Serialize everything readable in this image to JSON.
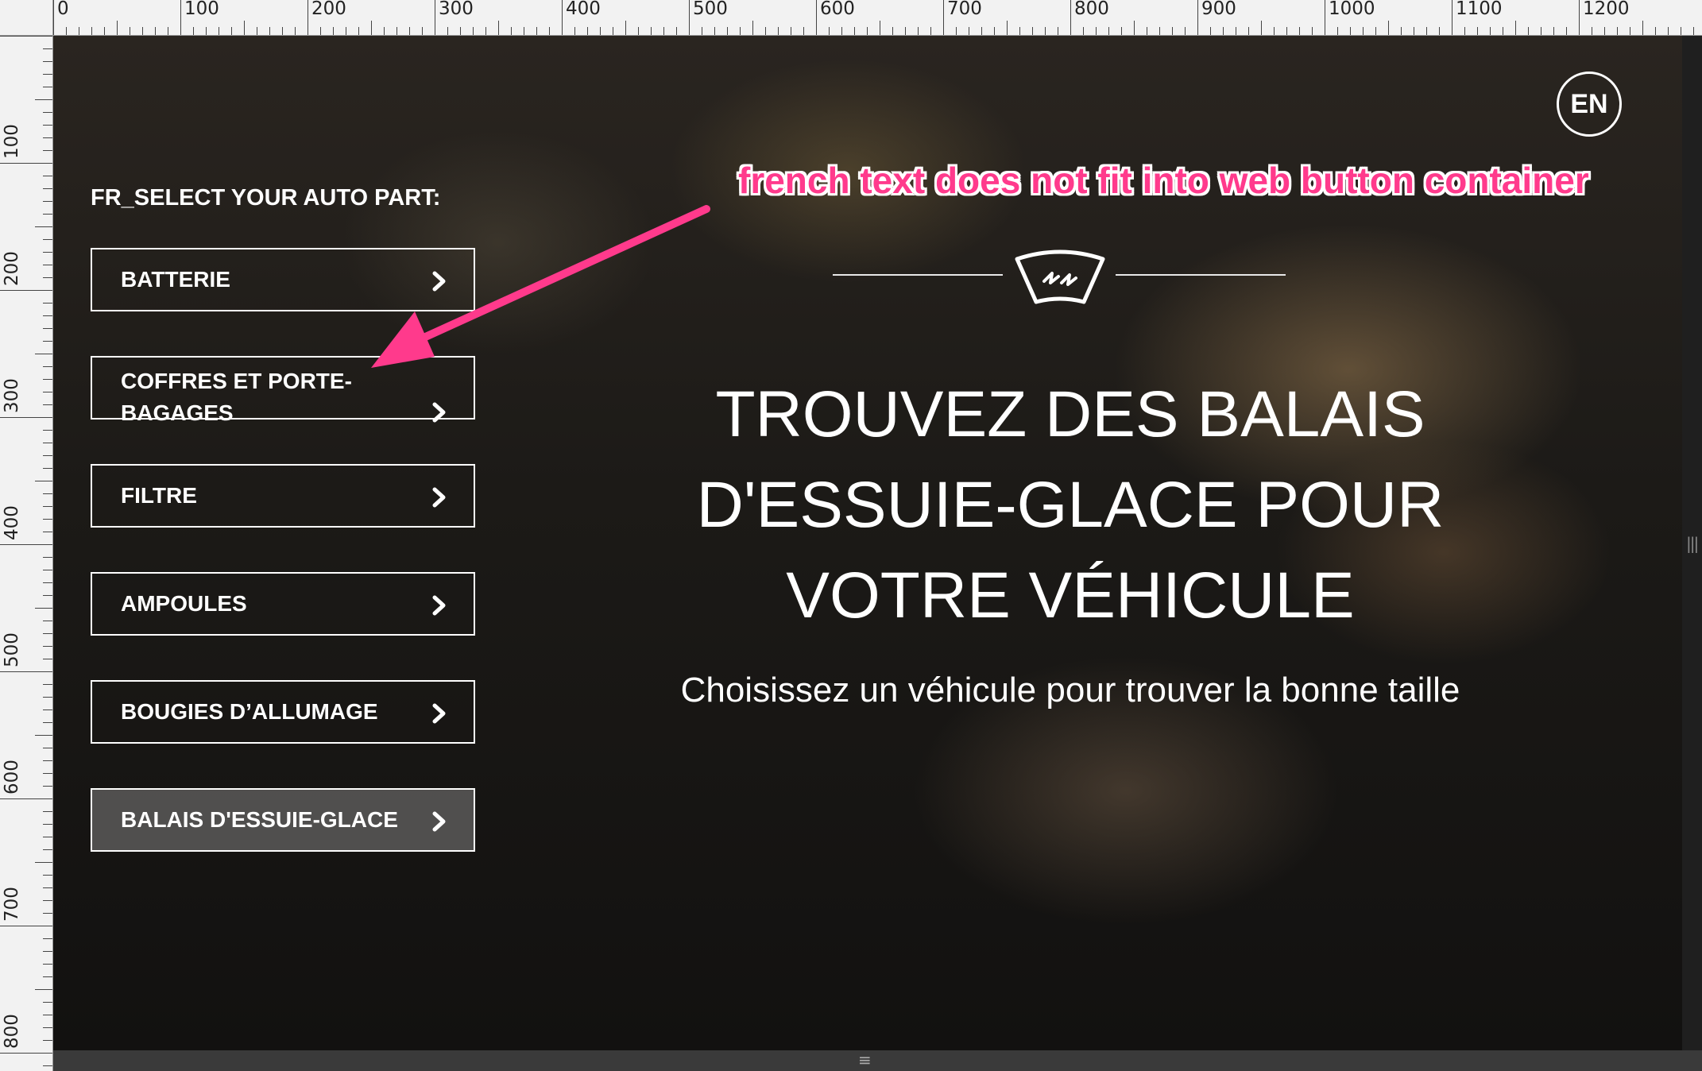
{
  "ruler": {
    "top_labels": [
      "0",
      "100",
      "200",
      "300",
      "400",
      "500",
      "600",
      "700",
      "800",
      "900",
      "1000",
      "1100",
      "1200"
    ],
    "left_labels": [
      "0",
      "100",
      "200",
      "300",
      "400",
      "500",
      "600",
      "700",
      "800"
    ]
  },
  "language_toggle": "EN",
  "sidebar": {
    "title": "FR_SELECT YOUR AUTO PART:",
    "parts": [
      {
        "label": "BATTERIE"
      },
      {
        "label": "COFFRES ET PORTE-BAGAGES"
      },
      {
        "label": "FILTRE"
      },
      {
        "label": "AMPOULES"
      },
      {
        "label": "BOUGIES D’ALLUMAGE"
      },
      {
        "label": "BALAIS D'ESSUIE-GLACE"
      }
    ]
  },
  "hero": {
    "title": "TROUVEZ DES BALAIS D'ESSUIE-GLACE POUR VOTRE VÉHICULE",
    "subtitle": "Choisissez un véhicule pour trouver la bonne taille"
  },
  "annotation": {
    "text": "french text does not fit into web button container",
    "color": "#ff3a8c"
  }
}
